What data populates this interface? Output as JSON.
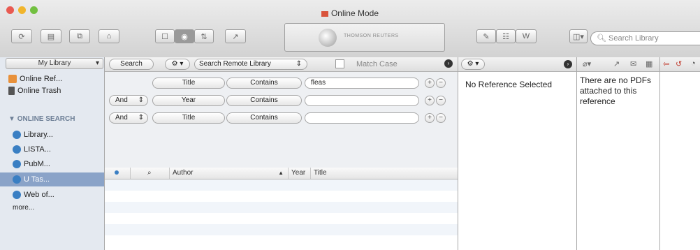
{
  "window": {
    "title": "Online Mode"
  },
  "toolbar": {
    "brand": "THOMSON REUTERS",
    "search_library_placeholder": "Search Library"
  },
  "sidebar": {
    "header": "My Library",
    "items": [
      {
        "label": "Online Ref...",
        "icon": "online-references-icon"
      },
      {
        "label": "Online Trash",
        "icon": "trash-icon"
      }
    ],
    "section_title": "ONLINE SEARCH",
    "online_items": [
      {
        "label": "Library..."
      },
      {
        "label": "LISTA..."
      },
      {
        "label": "PubM..."
      },
      {
        "label": "U Tas...",
        "selected": true
      },
      {
        "label": "Web of..."
      }
    ],
    "more": "more..."
  },
  "search_panel": {
    "search_button": "Search",
    "remote_select": "Search Remote Library",
    "match_case": "Match Case",
    "rows": [
      {
        "bool": "",
        "field": "Title",
        "operator": "Contains",
        "value": "fleas"
      },
      {
        "bool": "And",
        "field": "Year",
        "operator": "Contains",
        "value": ""
      },
      {
        "bool": "And",
        "field": "Title",
        "operator": "Contains",
        "value": ""
      }
    ]
  },
  "results_table": {
    "columns": [
      "Author",
      "Year",
      "Title"
    ]
  },
  "reference_pane": {
    "message": "No Reference Selected"
  },
  "pdf_pane": {
    "message": "There are no PDFs attached to this reference"
  },
  "colors": {
    "selection": "#8aa3c8",
    "sidebar_bg": "#e4e9f0",
    "accent_blue": "#3a7fc3"
  }
}
